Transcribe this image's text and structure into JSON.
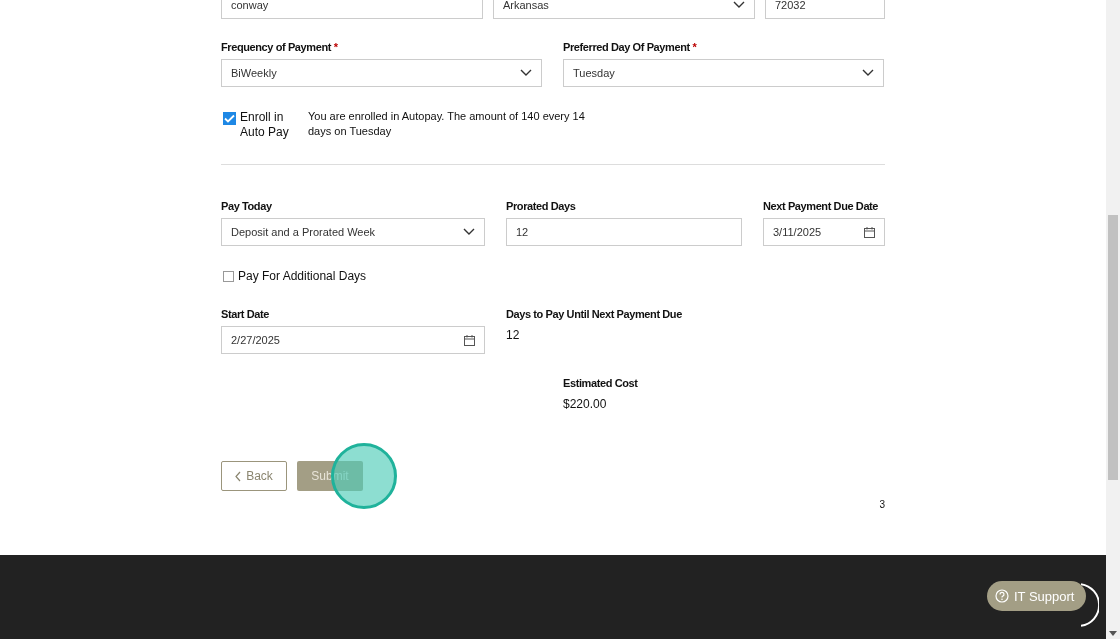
{
  "address": [
    {
      "kind": "text",
      "value": "conway"
    },
    {
      "kind": "select",
      "value": "Arkansas"
    },
    {
      "kind": "text",
      "value": "72032"
    }
  ],
  "payment_schedule": [
    {
      "label": "Frequency of Payment",
      "required": true,
      "kind": "select",
      "value": "BiWeekly"
    },
    {
      "label": "Preferred Day Of Payment",
      "required": true,
      "kind": "select",
      "value": "Tuesday"
    }
  ],
  "required_mark": "*",
  "autopay": {
    "label": "Enroll in Auto Pay",
    "checked": true,
    "message": "You are enrolled in Autopay. The amount of 140 every 14 days on Tuesday"
  },
  "pay_fields": [
    {
      "label": "Pay Today",
      "kind": "select",
      "value": "Deposit and a Prorated Week"
    },
    {
      "label": "Prorated Days",
      "kind": "text",
      "value": "12"
    },
    {
      "label": "Next Payment Due Date",
      "kind": "date",
      "value": "3/11/2025"
    }
  ],
  "additional_days": {
    "label": "Pay For Additional Days",
    "checked": false
  },
  "start_date": {
    "label": "Start Date",
    "kind": "date",
    "value": "2/27/2025"
  },
  "days_to_pay": {
    "label": "Days to Pay Until Next Payment Due",
    "value": "12"
  },
  "estimated_cost": {
    "label": "Estimated Cost",
    "value": "$220.00"
  },
  "buttons": [
    {
      "label": "Back",
      "kind": "back"
    },
    {
      "label": "Submit",
      "kind": "submit"
    }
  ],
  "page_number": "3",
  "support_button": {
    "label": "IT Support"
  }
}
